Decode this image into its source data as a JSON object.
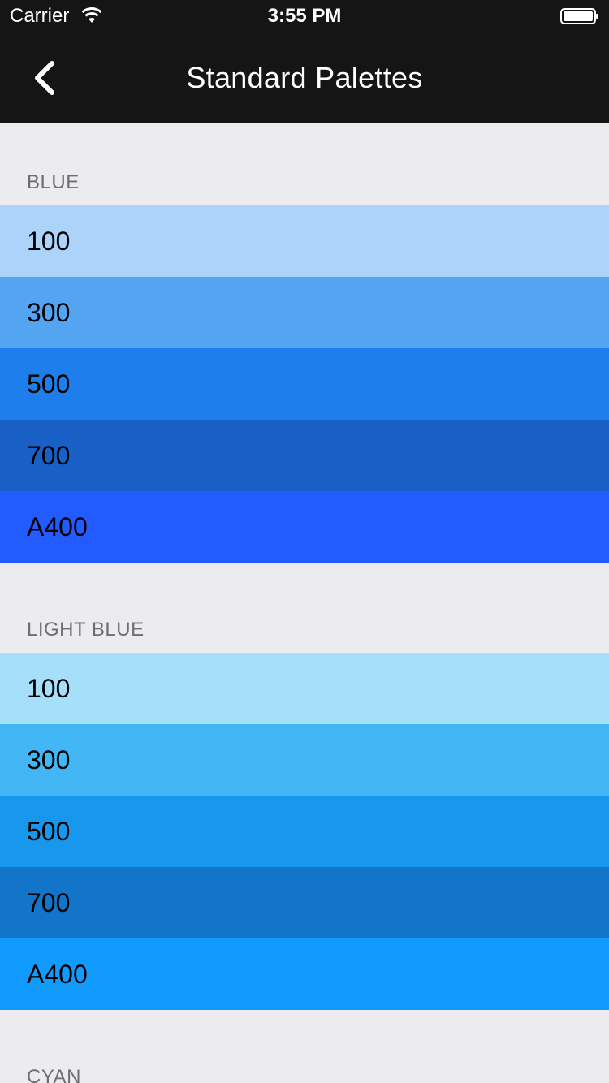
{
  "status_bar": {
    "carrier": "Carrier",
    "time": "3:55 PM",
    "wifi_icon": "wifi-icon",
    "battery_icon": "battery-icon"
  },
  "nav": {
    "back_icon": "chevron-left-icon",
    "title": "Standard Palettes"
  },
  "palettes": [
    {
      "name": "BLUE",
      "swatches": [
        {
          "label": "100",
          "color": "#ACD4FA"
        },
        {
          "label": "300",
          "color": "#53A5F1"
        },
        {
          "label": "500",
          "color": "#1E7FEC"
        },
        {
          "label": "700",
          "color": "#1860C6"
        },
        {
          "label": "A400",
          "color": "#225BFF"
        }
      ]
    },
    {
      "name": "LIGHT BLUE",
      "swatches": [
        {
          "label": "100",
          "color": "#A5DFFA"
        },
        {
          "label": "300",
          "color": "#43B6F5"
        },
        {
          "label": "500",
          "color": "#1798EC"
        },
        {
          "label": "700",
          "color": "#1275C9"
        },
        {
          "label": "A400",
          "color": "#129BFF"
        }
      ]
    },
    {
      "name": "CYAN",
      "swatches": []
    }
  ],
  "colors": {
    "bar_background": "#151515",
    "page_background": "#ECEBF0",
    "section_header_text": "#6D6D72"
  }
}
